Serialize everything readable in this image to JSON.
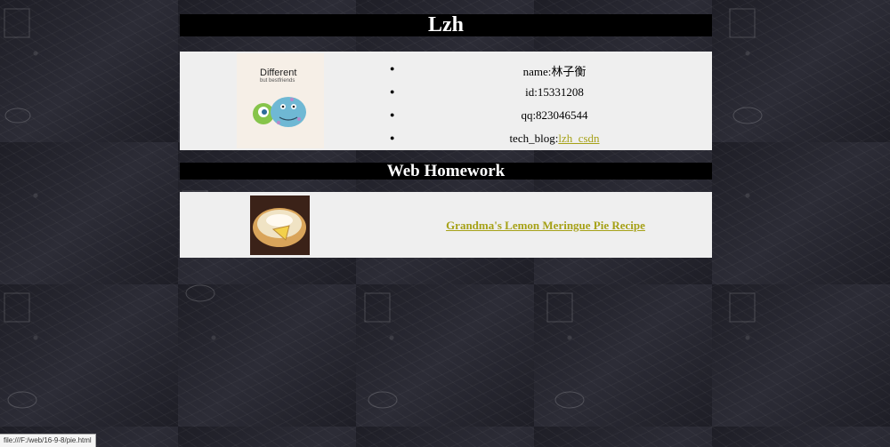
{
  "header": {
    "title": "Lzh"
  },
  "profile": {
    "avatar_caption_main": "Different",
    "avatar_caption_sub": "but bestfriends",
    "items": [
      {
        "label": "name:林子衡"
      },
      {
        "label": "id:15331208"
      },
      {
        "label": "qq:823046544"
      },
      {
        "label_prefix": "tech_blog:",
        "link_text": "lzh_csdn"
      }
    ]
  },
  "section": {
    "title": "Web Homework"
  },
  "homework": {
    "items": [
      {
        "link_text": "Grandma's Lemon Meringue Pie Recipe"
      }
    ]
  },
  "status_bar": {
    "url": "file:///F:/web/16-9-8/pie.html"
  },
  "colors": {
    "link": "#a6a117",
    "bar": "#000000",
    "card": "#efefef"
  }
}
